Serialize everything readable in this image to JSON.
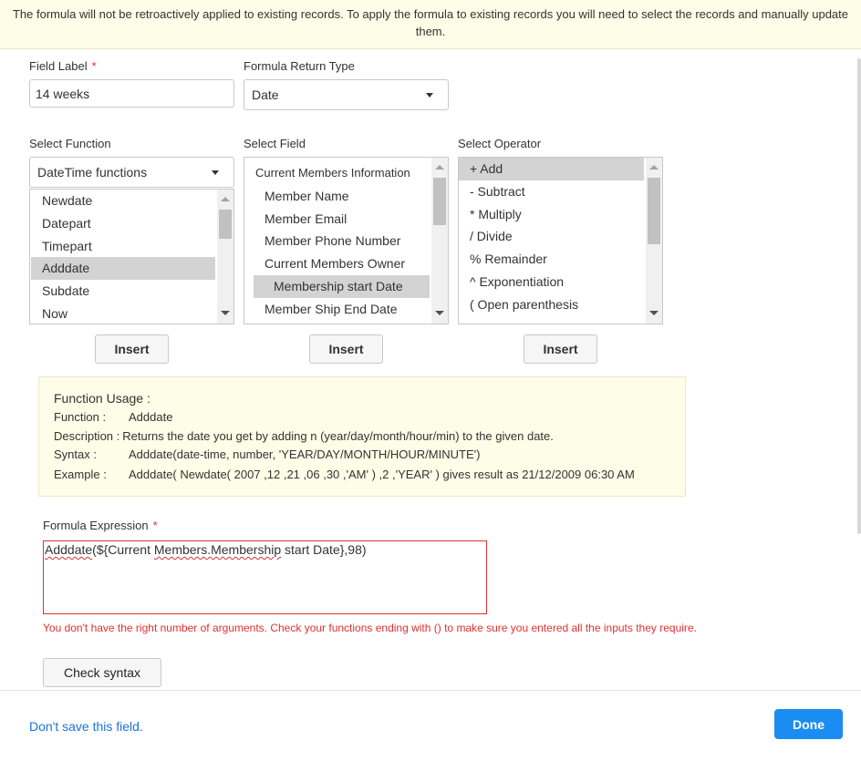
{
  "notice": {
    "text": "The formula will not be retroactively applied to existing records. To apply the formula to existing records you will need to select the records and manually update them."
  },
  "field_label": {
    "label": "Field Label",
    "required_marker": "*",
    "value": "14 weeks"
  },
  "return_type": {
    "label": "Formula Return Type",
    "value": "Date"
  },
  "select_function": {
    "label": "Select Function",
    "category": "DateTime functions",
    "items": [
      "Newdate",
      "Datepart",
      "Timepart",
      "Adddate",
      "Subdate",
      "Now"
    ],
    "selected": "Adddate",
    "insert_label": "Insert"
  },
  "select_field": {
    "label": "Select Field",
    "group_header": "Current Members Information",
    "items": [
      "Member Name",
      "Member Email",
      "Member Phone Number",
      "Current Members Owner",
      "Membership start Date",
      "Member Ship End Date"
    ],
    "selected": "Membership start Date",
    "insert_label": "Insert"
  },
  "select_operator": {
    "label": "Select Operator",
    "items": [
      "+ Add",
      "- Subtract",
      "* Multiply",
      "/ Divide",
      "% Remainder",
      "^ Exponentiation",
      "( Open parenthesis"
    ],
    "selected": "+ Add",
    "insert_label": "Insert"
  },
  "usage": {
    "title": "Function Usage :",
    "function_key": "Function :",
    "function_val": "Adddate",
    "description_key": "Description :",
    "description_val": "Returns the date you get by adding n (year/day/month/hour/min) to the given date.",
    "syntax_key": "Syntax :",
    "syntax_val": "Adddate(date-time, number, 'YEAR/DAY/MONTH/HOUR/MINUTE')",
    "example_key": "Example :",
    "example_val": "Adddate( Newdate( 2007 ,12 ,21 ,06 ,30 ,'AM' ) ,2 ,'YEAR' ) gives result as 21/12/2009 06:30 AM"
  },
  "formula": {
    "label": "Formula Expression",
    "required_marker": "*",
    "part1": "Adddate",
    "part2": "(${Current ",
    "part3": "Members.Membership",
    "part4": " start Date},98)",
    "error": "You don't have the right number of arguments. Check your functions ending with () to make sure you entered all the inputs they require."
  },
  "check_syntax_label": "Check syntax",
  "footer": {
    "dont_save": "Don't save this field.",
    "done": "Done"
  },
  "colors": {
    "accent": "#1b8df2",
    "error": "#e0312f",
    "link": "#1a73d8",
    "notice_bg": "#fefde7"
  }
}
